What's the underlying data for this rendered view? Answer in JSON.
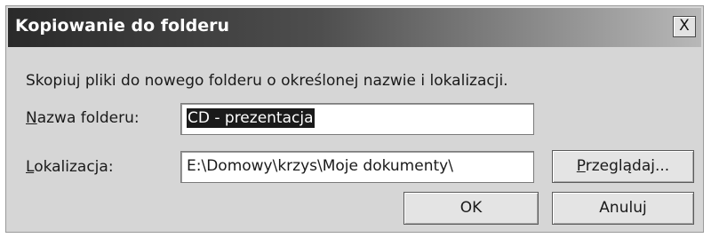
{
  "dialog": {
    "title": "Kopiowanie do folderu",
    "close_label": "X",
    "message": "Skopiuj pliki do nowego folderu o określonej nazwie i lokalizacji."
  },
  "folder_name": {
    "label_accel": "N",
    "label_rest": "azwa folderu:",
    "value": "CD - prezentacja"
  },
  "location": {
    "label_accel": "L",
    "label_rest": "okalizacja:",
    "value": "E:\\Domowy\\krzys\\Moje dokumenty\\"
  },
  "buttons": {
    "browse_accel": "P",
    "browse_rest": "rzeglądaj...",
    "ok": "OK",
    "cancel": "Anuluj"
  }
}
